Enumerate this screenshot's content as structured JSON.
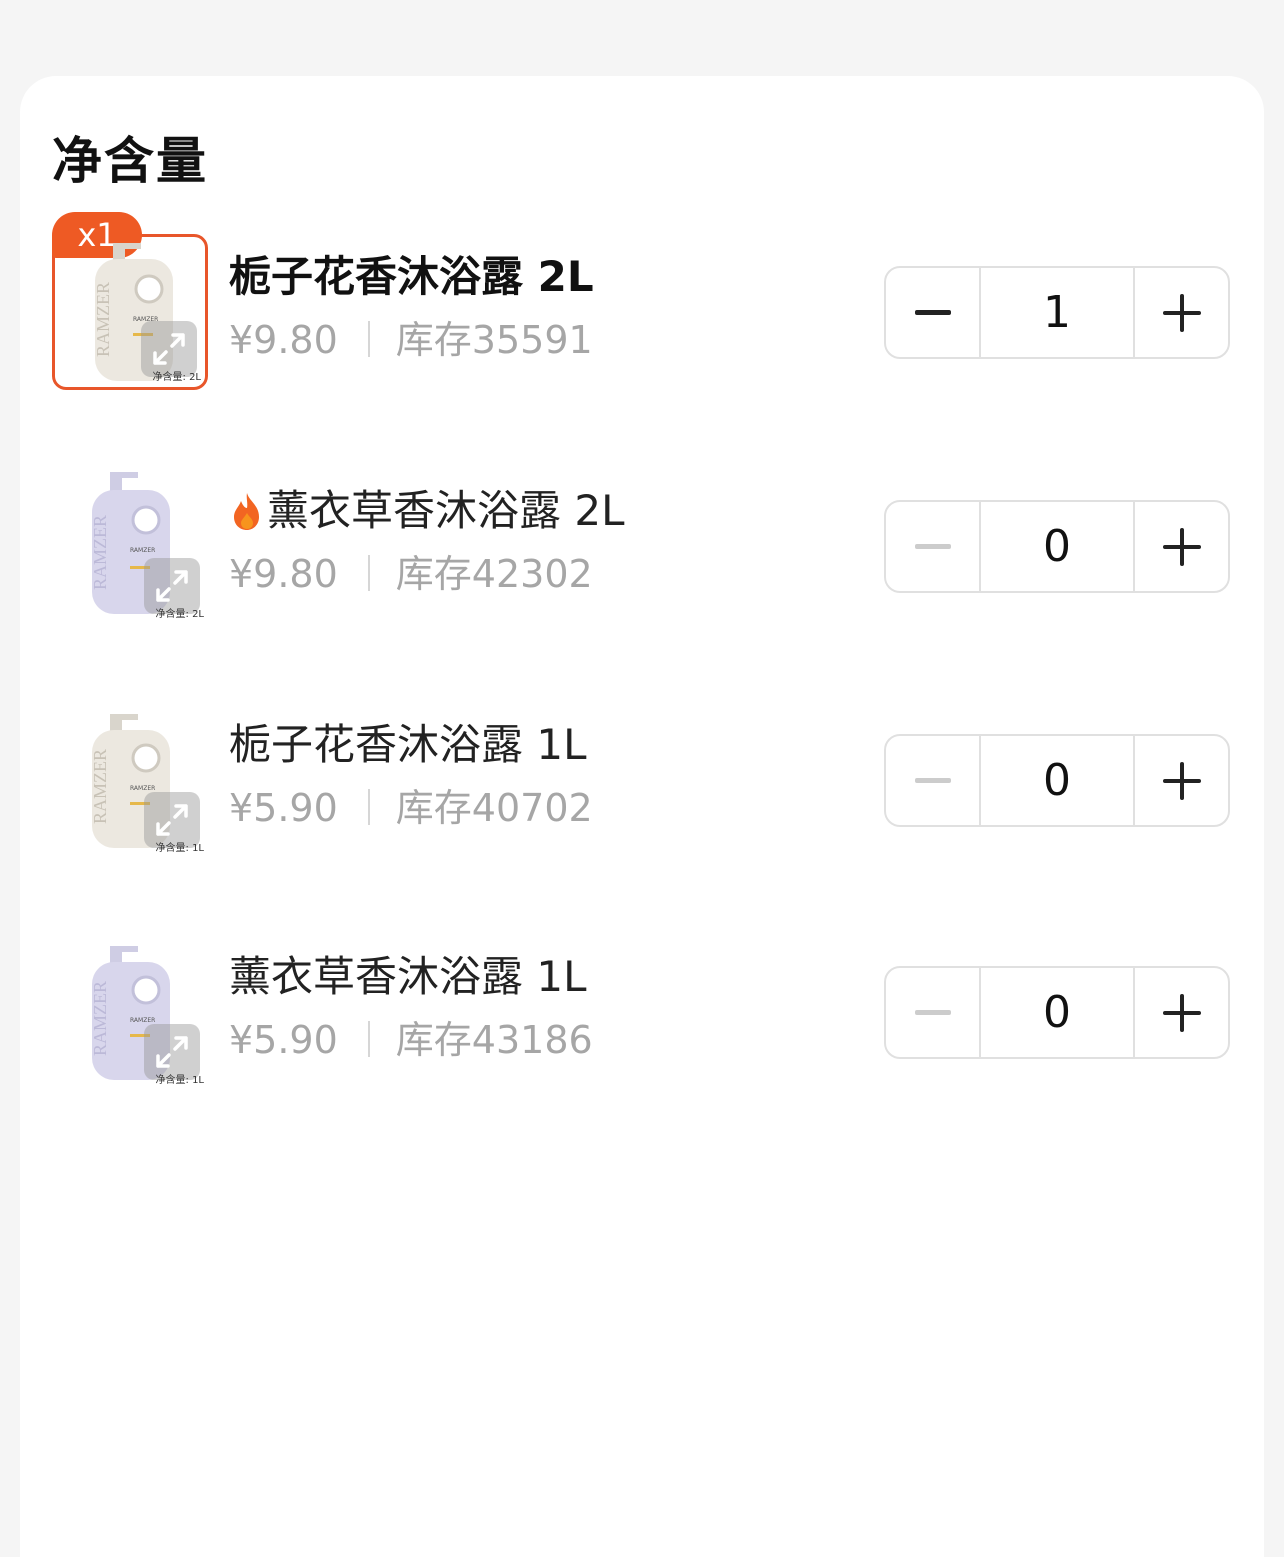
{
  "section": {
    "title": "净含量"
  },
  "colors": {
    "accent": "#ee5a24",
    "bottle_white": "#ece8e0",
    "bottle_purple": "#d8d6ec"
  },
  "items": [
    {
      "name": "栀子花香沐浴露 2L",
      "price": "¥9.80",
      "stock": "库存35591",
      "quantity": "1",
      "selected": true,
      "badge": "x1",
      "hot": false,
      "bottle_color": "white",
      "bottle_brand": "RAMZER",
      "volume_tag": "净含量: 2L"
    },
    {
      "name": "薰衣草香沐浴露 2L",
      "price": "¥9.80",
      "stock": "库存42302",
      "quantity": "0",
      "selected": false,
      "hot": true,
      "hot_icon": "fire-icon",
      "bottle_color": "purple",
      "bottle_brand": "RAMZER",
      "volume_tag": "净含量: 2L"
    },
    {
      "name": "栀子花香沐浴露 1L",
      "price": "¥5.90",
      "stock": "库存40702",
      "quantity": "0",
      "selected": false,
      "hot": false,
      "bottle_color": "white",
      "bottle_brand": "RAMZER",
      "volume_tag": "净含量: 1L"
    },
    {
      "name": "薰衣草香沐浴露 1L",
      "price": "¥5.90",
      "stock": "库存43186",
      "quantity": "0",
      "selected": false,
      "hot": false,
      "bottle_color": "purple",
      "bottle_brand": "RAMZER",
      "volume_tag": "净含量: 1L"
    }
  ]
}
